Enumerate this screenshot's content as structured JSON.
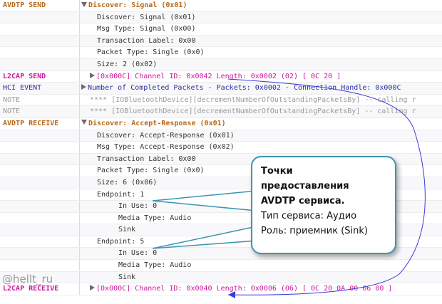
{
  "log": {
    "rows": [
      {
        "type": "AVDTP SEND",
        "detail": "Discover: Signal (0x01)",
        "level": 0,
        "expand": "down",
        "style": "avdtp"
      },
      {
        "type": "",
        "detail": "Discover: Signal (0x01)",
        "level": 1,
        "style": "plain"
      },
      {
        "type": "",
        "detail": "Msg Type: Signal (0x00)",
        "level": 1,
        "style": "plain"
      },
      {
        "type": "",
        "detail": "Transaction Label: 0x00",
        "level": 1,
        "style": "plain"
      },
      {
        "type": "",
        "detail": "Packet Type: Single (0x0)",
        "level": 1,
        "style": "plain"
      },
      {
        "type": "",
        "detail": "Size: 2 (0x02)",
        "level": 1,
        "style": "plain"
      },
      {
        "type": "L2CAP SEND",
        "detail": "[0x000C] Channel ID: 0x0042  Length: 0x0002 (02) [ 0C 20 ]",
        "level": "c",
        "expand": "right",
        "style": "l2cap"
      },
      {
        "type": "HCI EVENT",
        "detail": "Number of Completed Packets - Packets: 0x0002 - Connection Handle: 0x000C",
        "level": 0,
        "expand": "right",
        "style": "hci"
      },
      {
        "type": "NOTE",
        "detail": "**** [IOBluetoothDevice][decrementNumberOfOutstandingPacketsBy] -- calling r",
        "level": "c",
        "style": "note"
      },
      {
        "type": "NOTE",
        "detail": "**** [IOBluetoothDevice][decrementNumberOfOutstandingPacketsBy] -- calling r",
        "level": "c",
        "style": "note"
      },
      {
        "type": "AVDTP RECEIVE",
        "detail": "Discover: Accept-Response (0x01)",
        "level": 0,
        "expand": "down",
        "style": "avdtp"
      },
      {
        "type": "",
        "detail": "Discover: Accept-Response (0x01)",
        "level": 1,
        "style": "plain"
      },
      {
        "type": "",
        "detail": "Msg Type: Accept-Response (0x02)",
        "level": 1,
        "style": "plain"
      },
      {
        "type": "",
        "detail": "Transaction Label: 0x00",
        "level": 1,
        "style": "plain"
      },
      {
        "type": "",
        "detail": "Packet Type: Single (0x0)",
        "level": 1,
        "style": "plain"
      },
      {
        "type": "",
        "detail": "Size: 6 (0x06)",
        "level": 1,
        "style": "plain"
      },
      {
        "type": "",
        "detail": "Endpoint: 1",
        "level": 1,
        "style": "plain"
      },
      {
        "type": "",
        "detail": "In Use: 0",
        "level": 2,
        "style": "plain"
      },
      {
        "type": "",
        "detail": "Media Type: Audio",
        "level": 2,
        "style": "plain"
      },
      {
        "type": "",
        "detail": "Sink",
        "level": 2,
        "style": "plain"
      },
      {
        "type": "",
        "detail": "Endpoint: 5",
        "level": 1,
        "style": "plain"
      },
      {
        "type": "",
        "detail": "In Use: 0",
        "level": 2,
        "style": "plain"
      },
      {
        "type": "",
        "detail": "Media Type: Audio",
        "level": 2,
        "style": "plain"
      },
      {
        "type": "",
        "detail": "Sink",
        "level": 2,
        "style": "plain"
      },
      {
        "type": "L2CAP RECEIVE",
        "detail": "[0x000C] Channel ID: 0x0040  Length: 0x0006 (06) [ 0C 20 0A 00 06 00 ]",
        "level": "c",
        "expand": "right",
        "style": "l2cap"
      }
    ]
  },
  "callout": {
    "line1": "Точки",
    "line2": "предоставления",
    "line3": "AVDTP сервиса.",
    "line4": "Тип сервиса: Аудио",
    "line5": "Роль: приемник (Sink)"
  },
  "watermark": "@hellt_ru",
  "colors": {
    "avdtp": "#b8681a",
    "l2cap": "#d0159f",
    "hci": "#2a2f9a",
    "note": "#9a9a9a",
    "callout_border": "#3b95b0",
    "arrow": "#3a3ad8"
  }
}
